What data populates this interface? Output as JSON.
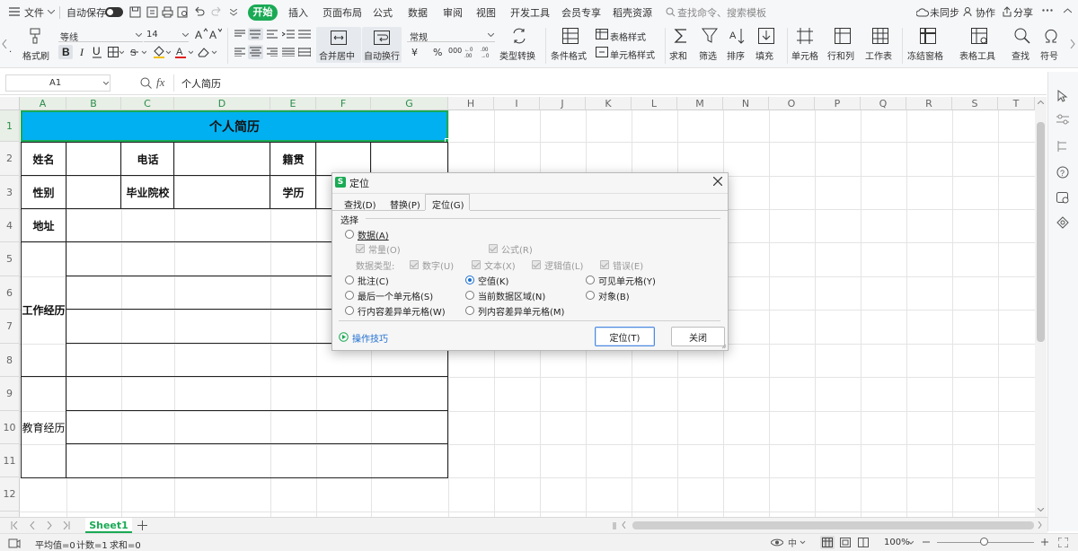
{
  "menubar": {
    "file": "文件",
    "autosave": "自动保存",
    "tabs": [
      "开始",
      "插入",
      "页面布局",
      "公式",
      "数据",
      "审阅",
      "视图",
      "开发工具",
      "会员专享",
      "稻壳资源"
    ],
    "search_placeholder": "查找命令、搜索模板",
    "sync": "未同步",
    "collab": "协作",
    "share": "分享"
  },
  "ribbon": {
    "format_painter": "格式刷",
    "paste_partial": "·",
    "font_name": "等线",
    "font_size": "14",
    "merge_center": "合并居中",
    "wrap_text": "自动换行",
    "number_format": "常规",
    "type_convert": "类型转换",
    "cond_format": "条件格式",
    "table_style": "表格样式",
    "cell_style": "单元格样式",
    "sum": "求和",
    "filter": "筛选",
    "sort": "排序",
    "fill": "填充",
    "cells": "单元格",
    "row_col": "行和列",
    "worksheet": "工作表",
    "freeze": "冻结窗格",
    "table_tools": "表格工具",
    "find": "查找",
    "symbol": "符号",
    "currency_symbol": "¥",
    "percent_symbol": "%",
    "thousands_symbol": "000"
  },
  "formula_bar": {
    "cell_ref": "A1",
    "content": "个人简历"
  },
  "columns": [
    "A",
    "B",
    "C",
    "D",
    "E",
    "F",
    "G",
    "H",
    "I",
    "J",
    "K",
    "L",
    "M",
    "N",
    "O",
    "P",
    "Q",
    "R",
    "S",
    "T"
  ],
  "rows": [
    "1",
    "2",
    "3",
    "4",
    "5",
    "6",
    "7",
    "8",
    "9",
    "10",
    "11",
    "12"
  ],
  "resume": {
    "title": "个人简历",
    "name": "姓名",
    "phone": "电话",
    "native": "籍贯",
    "gender": "性别",
    "school": "毕业院校",
    "education": "学历",
    "address": "地址",
    "work": "工作经历",
    "study": "教育经历"
  },
  "dialog": {
    "title": "定位",
    "tabs": [
      "查找(D)",
      "替换(P)",
      "定位(G)"
    ],
    "group": "选择",
    "data": "数据(A)",
    "constant": "常量(O)",
    "formula": "公式(R)",
    "data_type": "数据类型:",
    "number": "数字(U)",
    "text": "文本(X)",
    "logical": "逻辑值(L)",
    "error": "错误(E)",
    "comment": "批注(C)",
    "blank": "空值(K)",
    "visible": "可见单元格(Y)",
    "last_cell": "最后一个单元格(S)",
    "current_region": "当前数据区域(N)",
    "objects": "对象(B)",
    "row_diff": "行内容差异单元格(W)",
    "col_diff": "列内容差异单元格(M)",
    "tips": "操作技巧",
    "ok": "定位(T)",
    "close": "关闭"
  },
  "sheet_tab": "Sheet1",
  "status": {
    "average": "平均值=0",
    "count": "计数=1",
    "sum": "求和=0",
    "zoom": "100%"
  }
}
